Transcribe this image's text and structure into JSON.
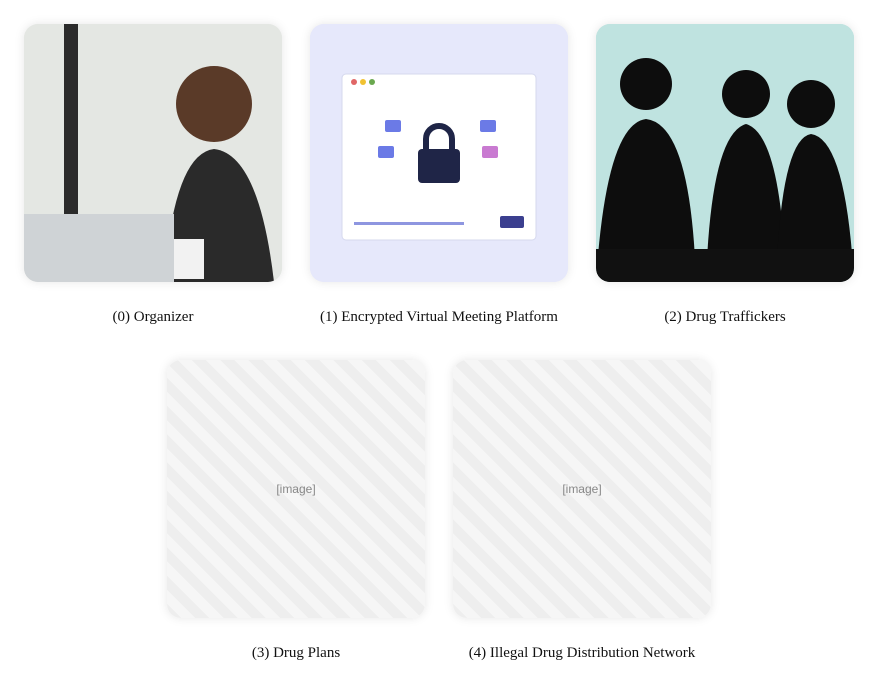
{
  "tiles": [
    {
      "caption": "(0) Organizer",
      "icon": "person-laptop-illustration"
    },
    {
      "caption": "(1) Encrypted Virtual Meeting Platform",
      "icon": "lock-window-illustration"
    },
    {
      "caption": "(2) Drug Traffickers",
      "icon": "silhouette-group-illustration"
    },
    {
      "caption": "(3) Drug Plans",
      "icon": "image-placeholder"
    },
    {
      "caption": "(4) Illegal Drug Distribution Network",
      "icon": "image-placeholder"
    }
  ]
}
